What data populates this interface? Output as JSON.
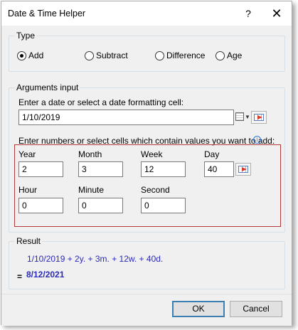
{
  "window": {
    "title": "Date & Time Helper",
    "help_icon": "?",
    "close_icon": "✕"
  },
  "type_group": {
    "label": "Type",
    "options": [
      {
        "label": "Add",
        "checked": true
      },
      {
        "label": "Subtract",
        "checked": false
      },
      {
        "label": "Difference",
        "checked": false
      },
      {
        "label": "Age",
        "checked": false
      }
    ]
  },
  "arguments": {
    "label": "Arguments input",
    "date_prompt": "Enter a date or select a date formatting cell:",
    "date_value": "1/10/2019",
    "numbers_prompt": "Enter numbers or select cells which contain values you want to add:",
    "fields": {
      "year": {
        "label": "Year",
        "value": "2"
      },
      "month": {
        "label": "Month",
        "value": "3"
      },
      "week": {
        "label": "Week",
        "value": "12"
      },
      "day": {
        "label": "Day",
        "value": "40"
      },
      "hour": {
        "label": "Hour",
        "value": "0"
      },
      "minute": {
        "label": "Minute",
        "value": "0"
      },
      "second": {
        "label": "Second",
        "value": "0"
      }
    }
  },
  "result": {
    "label": "Result",
    "formula": "1/10/2019 + 2y. + 3m. + 12w. + 40d.",
    "equals": "=",
    "value": "8/12/2021"
  },
  "buttons": {
    "ok": "OK",
    "cancel": "Cancel"
  },
  "colors": {
    "result_text": "#2a2ab8",
    "highlight_border": "#b33a3a",
    "default_button_border": "#3c7fb1"
  }
}
